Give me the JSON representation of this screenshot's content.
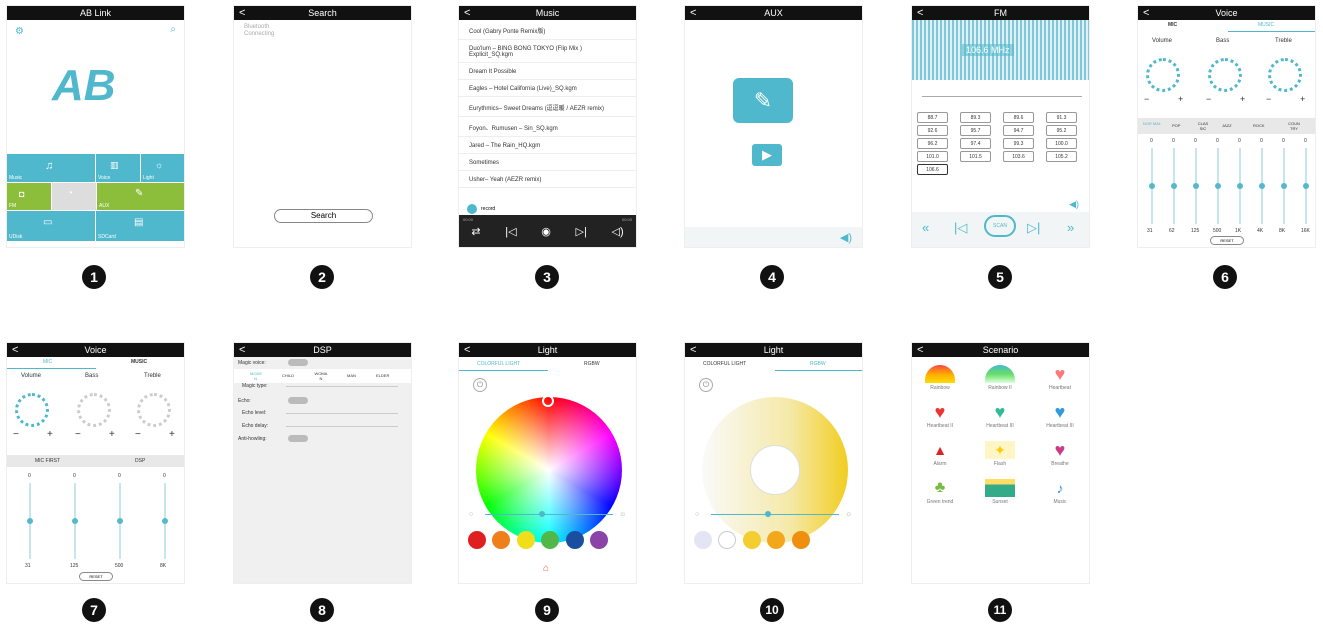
{
  "screens": {
    "s1": {
      "title": "AB Link",
      "logo": "AB",
      "tiles": [
        "Music",
        "Voice",
        "Light",
        "FM",
        "",
        "AUX",
        "UDisk",
        "SDCard"
      ]
    },
    "s2": {
      "title": "Search",
      "device": "Bluetooth",
      "status": "Connecting",
      "button": "Search"
    },
    "s3": {
      "title": "Music",
      "tracks": [
        "Cool (Gabry Ponte Remix版)",
        "Duo'lum – BING BONG TOKYO (Flip Mix ) Explicit_SQ.kgm",
        "Dream It Possible",
        "Eagles – Hotel California (Live)_SQ.kgm",
        "Eurythmics– Sweet Dreams (逗逗暖 / AEZR remix)",
        "Foyon、Rumusen – Sin_SQ.kgm",
        "Jared – The Rain_HQ.kgm",
        "Sometimes",
        "Usher– Yeah (AEZR remix)"
      ],
      "now_playing": "record",
      "time_start": "00:00",
      "time_end": "00:00"
    },
    "s4": {
      "title": "AUX"
    },
    "s5": {
      "title": "FM",
      "freq": "106.6 MHz",
      "presets": [
        "88.7",
        "89.3",
        "89.6",
        "91.3",
        "92.6",
        "95.7",
        "94.7",
        "95.2",
        "96.2",
        "97.4",
        "99.3",
        "100.0",
        "101.0",
        "101.5",
        "103.6",
        "105.2",
        "106.6"
      ],
      "scan": "SCAN"
    },
    "s6": {
      "title": "Voice",
      "tabs": [
        "MIC",
        "MUSIC"
      ],
      "dials": [
        "Volume",
        "Bass",
        "Treble"
      ],
      "eq_modes": [
        "NOR MAL",
        "POP",
        "CLAS SIC",
        "JAZZ",
        "ROCK",
        "COUN TRY"
      ],
      "bands": [
        "31",
        "62",
        "125",
        "500",
        "1K",
        "4K",
        "8K",
        "16K"
      ],
      "vals": [
        "0",
        "0",
        "0",
        "0",
        "0",
        "0",
        "0",
        "0"
      ],
      "reset": "RESET"
    },
    "s7": {
      "title": "Voice",
      "tabs": [
        "MIC",
        "MUSIC"
      ],
      "dials": [
        "Volume",
        "Bass",
        "Treble"
      ],
      "sections": [
        "MIC FIRST",
        "DSP"
      ],
      "bands": [
        "31",
        "125",
        "500",
        "8K"
      ],
      "vals": [
        "0",
        "0",
        "0",
        "0"
      ],
      "reset": "RESET"
    },
    "s8": {
      "title": "DSP",
      "magic_voice": "Magic voice:",
      "types": [
        "MODE N.",
        "CHILD",
        "WOMA N",
        "MAN",
        "ELDER"
      ],
      "magic_type": "Magic type:",
      "echo": "Echo:",
      "echo_level": "Echo level:",
      "echo_delay": "Echo delay:",
      "anti": "Anti-howling:"
    },
    "s9": {
      "title": "Light",
      "tabs": [
        "COLORFUL LIGHT",
        "RGBW"
      ]
    },
    "s10": {
      "title": "Light",
      "tabs": [
        "COLORFUL LIGHT",
        "RGBW"
      ]
    },
    "s11": {
      "title": "Scenario",
      "items": [
        "Rainbow",
        "Rainbow II",
        "Heartbeat",
        "Heartbeat II",
        "Heartbeat III",
        "Heartbeat III",
        "Alarm",
        "Flash",
        "Breathe",
        "Green trend",
        "Sunset",
        "Music"
      ]
    }
  },
  "numbers": [
    "1",
    "2",
    "3",
    "4",
    "5",
    "6",
    "7",
    "8",
    "9",
    "10",
    "11"
  ],
  "colors": {
    "accent": "#4fb8cc",
    "green": "#8cbd3b",
    "dark": "#111111"
  }
}
